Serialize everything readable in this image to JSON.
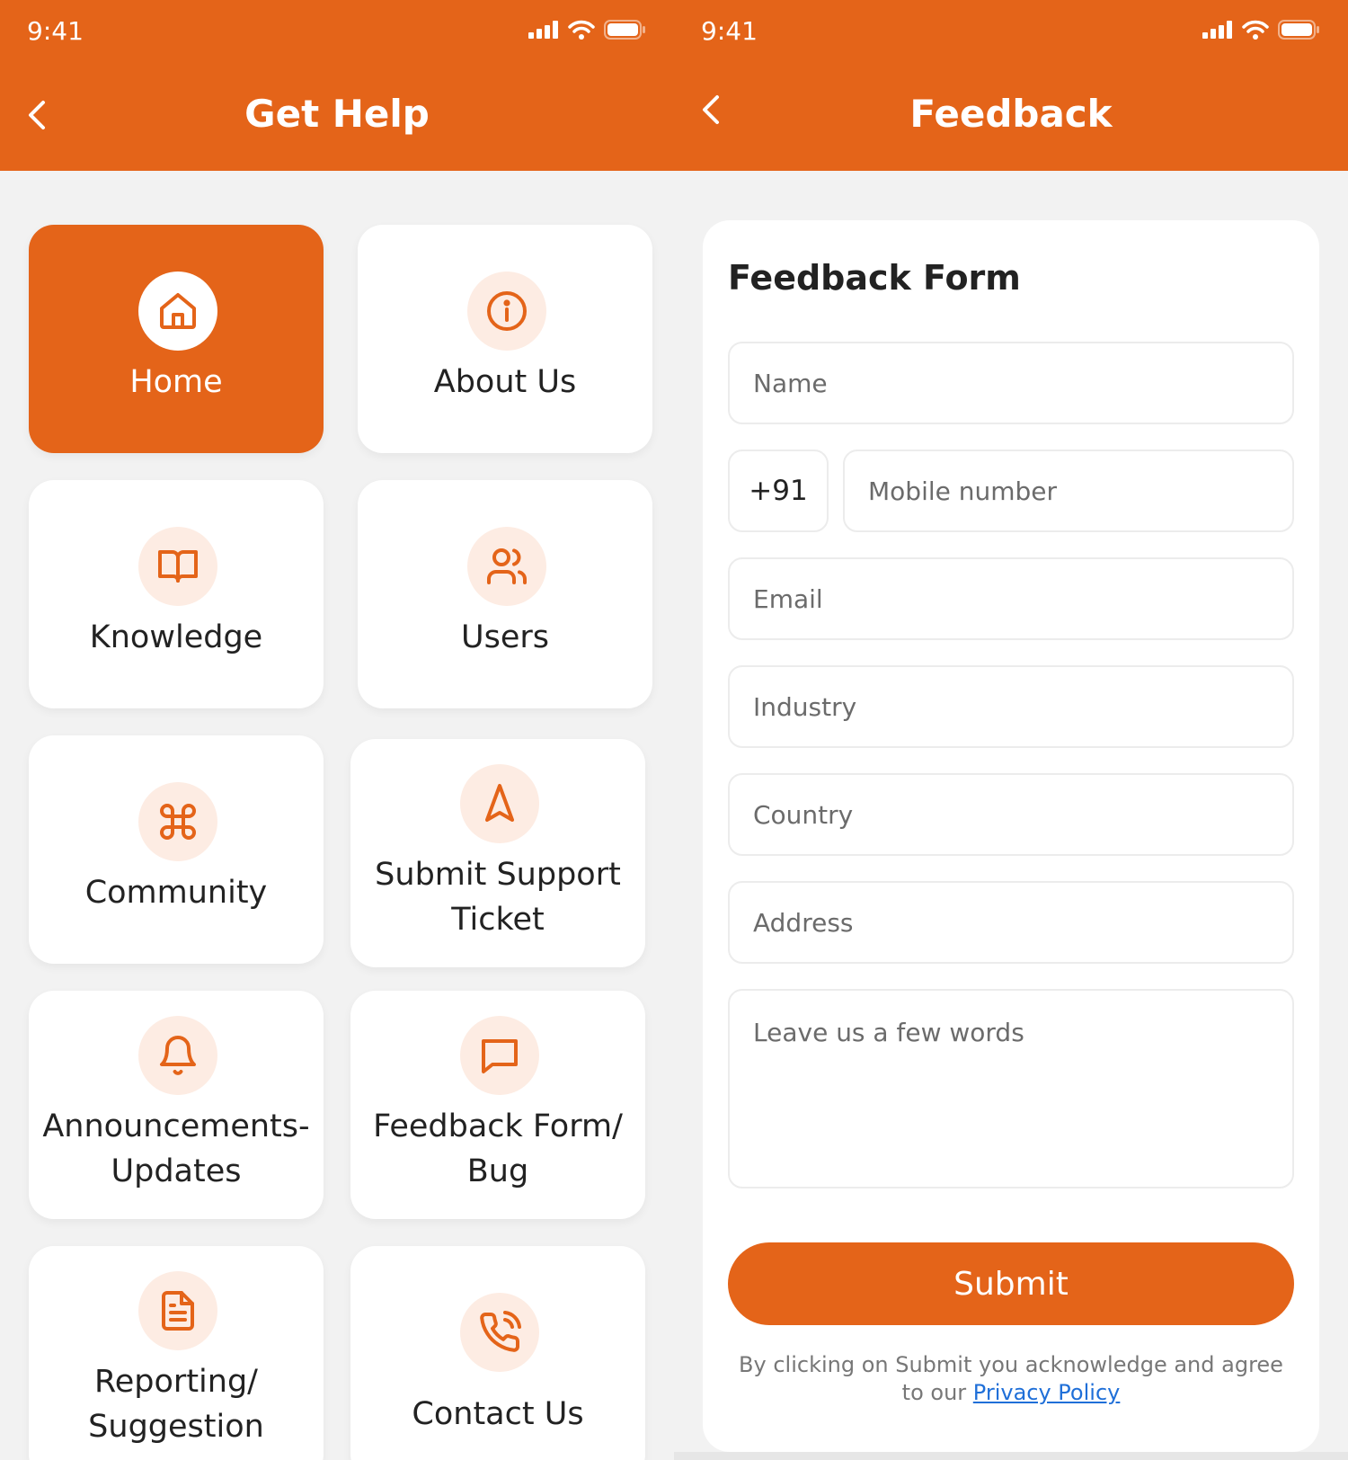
{
  "colors": {
    "accent": "#e46419",
    "icon_bg": "#fdece3",
    "link": "#1f6fd8"
  },
  "get_help": {
    "status_time": "9:41",
    "title": "Get Help",
    "tiles": [
      {
        "label": "Home",
        "icon": "home-icon",
        "active": true
      },
      {
        "label": "About Us",
        "icon": "info-icon"
      },
      {
        "label": "Knowledge",
        "icon": "book-icon"
      },
      {
        "label": "Users",
        "icon": "users-icon"
      },
      {
        "label": "Community",
        "icon": "command-icon"
      },
      {
        "label_1": "Submit Support",
        "label_2": "Ticket",
        "icon": "navigation-icon"
      },
      {
        "label_1": "Announcements-",
        "label_2": "Updates",
        "icon": "bell-icon"
      },
      {
        "label_1": "Feedback Form/",
        "label_2": "Bug",
        "icon": "message-icon"
      },
      {
        "label_1": "Reporting/",
        "label_2": "Suggestion",
        "icon": "document-icon"
      },
      {
        "label": "Contact Us",
        "icon": "phone-call-icon"
      }
    ]
  },
  "feedback": {
    "status_time": "9:41",
    "title": "Feedback",
    "form_title": "Feedback Form",
    "fields": {
      "name": "Name",
      "country_code": "+91",
      "mobile": "Mobile number",
      "email": "Email",
      "industry": "Industry",
      "country": "Country",
      "address": "Address",
      "message": "Leave us a few words"
    },
    "submit_label": "Submit",
    "legal_line1": "By clicking on Submit you acknowledge and agree",
    "legal_prefix": "to our",
    "privacy_link": "Privacy Policy"
  }
}
